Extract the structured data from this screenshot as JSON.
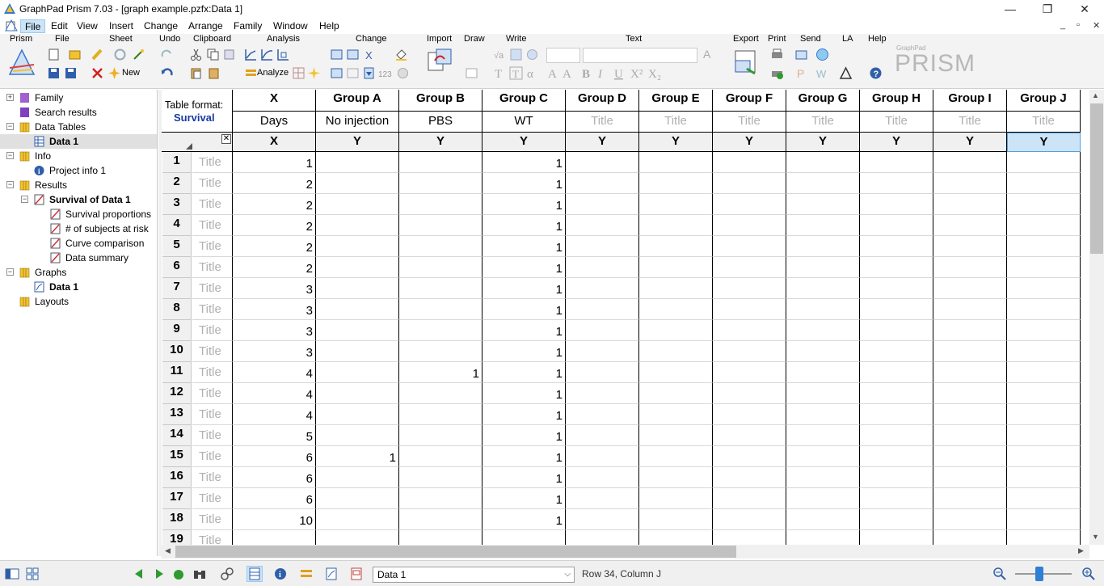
{
  "window": {
    "title": "GraphPad Prism 7.03 - [graph example.pzfx:Data 1]",
    "minimize": "—",
    "restore": "❐",
    "close": "✕",
    "mdi_min": "_",
    "mdi_restore": "▫",
    "mdi_close": "✕"
  },
  "menu": [
    "File",
    "Edit",
    "View",
    "Insert",
    "Change",
    "Arrange",
    "Family",
    "Window",
    "Help"
  ],
  "ribbon": {
    "groups": [
      "Prism",
      "File",
      "Sheet",
      "Undo",
      "Clipboard",
      "Analysis",
      "Change",
      "Import",
      "Draw",
      "Write",
      "Text",
      "Export",
      "Print",
      "Send",
      "LA",
      "Help"
    ],
    "new_label": "New",
    "analyze_label": "Analyze",
    "brand_small": "GraphPad",
    "brand": "PRISM"
  },
  "tree": [
    {
      "label": "Family",
      "level": 0,
      "expander": "+",
      "icon": "family-icon",
      "bold": false
    },
    {
      "label": "Search results",
      "level": 0,
      "expander": "",
      "icon": "search-results-icon",
      "bold": false
    },
    {
      "label": "Data Tables",
      "level": 0,
      "expander": "-",
      "icon": "folder-icon",
      "bold": false
    },
    {
      "label": "Data 1",
      "level": 1,
      "expander": "",
      "icon": "data-table-icon",
      "bold": true,
      "selected": true
    },
    {
      "label": "Info",
      "level": 0,
      "expander": "-",
      "icon": "folder-icon",
      "bold": false
    },
    {
      "label": "Project info 1",
      "level": 1,
      "expander": "",
      "icon": "info-icon",
      "bold": false
    },
    {
      "label": "Results",
      "level": 0,
      "expander": "-",
      "icon": "folder-icon",
      "bold": false
    },
    {
      "label": "Survival of Data 1",
      "level": 1,
      "expander": "-",
      "icon": "results-icon",
      "bold": true
    },
    {
      "label": "Survival proportions",
      "level": 2,
      "expander": "",
      "icon": "results-icon",
      "bold": false
    },
    {
      "label": "# of subjects at risk",
      "level": 2,
      "expander": "",
      "icon": "results-icon",
      "bold": false
    },
    {
      "label": "Curve comparison",
      "level": 2,
      "expander": "",
      "icon": "results-icon",
      "bold": false
    },
    {
      "label": "Data summary",
      "level": 2,
      "expander": "",
      "icon": "results-icon",
      "bold": false
    },
    {
      "label": "Graphs",
      "level": 0,
      "expander": "-",
      "icon": "folder-icon",
      "bold": false
    },
    {
      "label": "Data 1",
      "level": 1,
      "expander": "",
      "icon": "graph-icon",
      "bold": true
    },
    {
      "label": "Layouts",
      "level": 0,
      "expander": "",
      "icon": "folder-icon",
      "bold": false
    }
  ],
  "table": {
    "format_label": "Table format:",
    "format_value": "Survival",
    "x_header": "X",
    "x_title": "Days",
    "x_type": "X",
    "groups": [
      "Group A",
      "Group B",
      "Group C",
      "Group D",
      "Group E",
      "Group F",
      "Group G",
      "Group H",
      "Group I",
      "Group J"
    ],
    "group_titles": [
      "No injection",
      "PBS",
      "WT",
      "Title",
      "Title",
      "Title",
      "Title",
      "Title",
      "Title",
      "Title"
    ],
    "group_title_placeholder": [
      false,
      false,
      false,
      true,
      true,
      true,
      true,
      true,
      true,
      true
    ],
    "y_type": "Y",
    "row_title_placeholder": "Title",
    "rows": [
      {
        "n": "1",
        "x": "1",
        "a": "",
        "b": "",
        "c": "1"
      },
      {
        "n": "2",
        "x": "2",
        "a": "",
        "b": "",
        "c": "1"
      },
      {
        "n": "3",
        "x": "2",
        "a": "",
        "b": "",
        "c": "1"
      },
      {
        "n": "4",
        "x": "2",
        "a": "",
        "b": "",
        "c": "1"
      },
      {
        "n": "5",
        "x": "2",
        "a": "",
        "b": "",
        "c": "1"
      },
      {
        "n": "6",
        "x": "2",
        "a": "",
        "b": "",
        "c": "1"
      },
      {
        "n": "7",
        "x": "3",
        "a": "",
        "b": "",
        "c": "1"
      },
      {
        "n": "8",
        "x": "3",
        "a": "",
        "b": "",
        "c": "1"
      },
      {
        "n": "9",
        "x": "3",
        "a": "",
        "b": "",
        "c": "1"
      },
      {
        "n": "10",
        "x": "3",
        "a": "",
        "b": "",
        "c": "1"
      },
      {
        "n": "11",
        "x": "4",
        "a": "",
        "b": "1",
        "c": "1"
      },
      {
        "n": "12",
        "x": "4",
        "a": "",
        "b": "",
        "c": "1"
      },
      {
        "n": "13",
        "x": "4",
        "a": "",
        "b": "",
        "c": "1"
      },
      {
        "n": "14",
        "x": "5",
        "a": "",
        "b": "",
        "c": "1"
      },
      {
        "n": "15",
        "x": "6",
        "a": "1",
        "b": "",
        "c": "1"
      },
      {
        "n": "16",
        "x": "6",
        "a": "",
        "b": "",
        "c": "1"
      },
      {
        "n": "17",
        "x": "6",
        "a": "",
        "b": "",
        "c": "1"
      },
      {
        "n": "18",
        "x": "10",
        "a": "",
        "b": "",
        "c": "1"
      },
      {
        "n": "19",
        "x": "",
        "a": "",
        "b": "",
        "c": ""
      }
    ]
  },
  "status": {
    "sheet_selected": "Data 1",
    "position": "Row 34, Column J"
  }
}
